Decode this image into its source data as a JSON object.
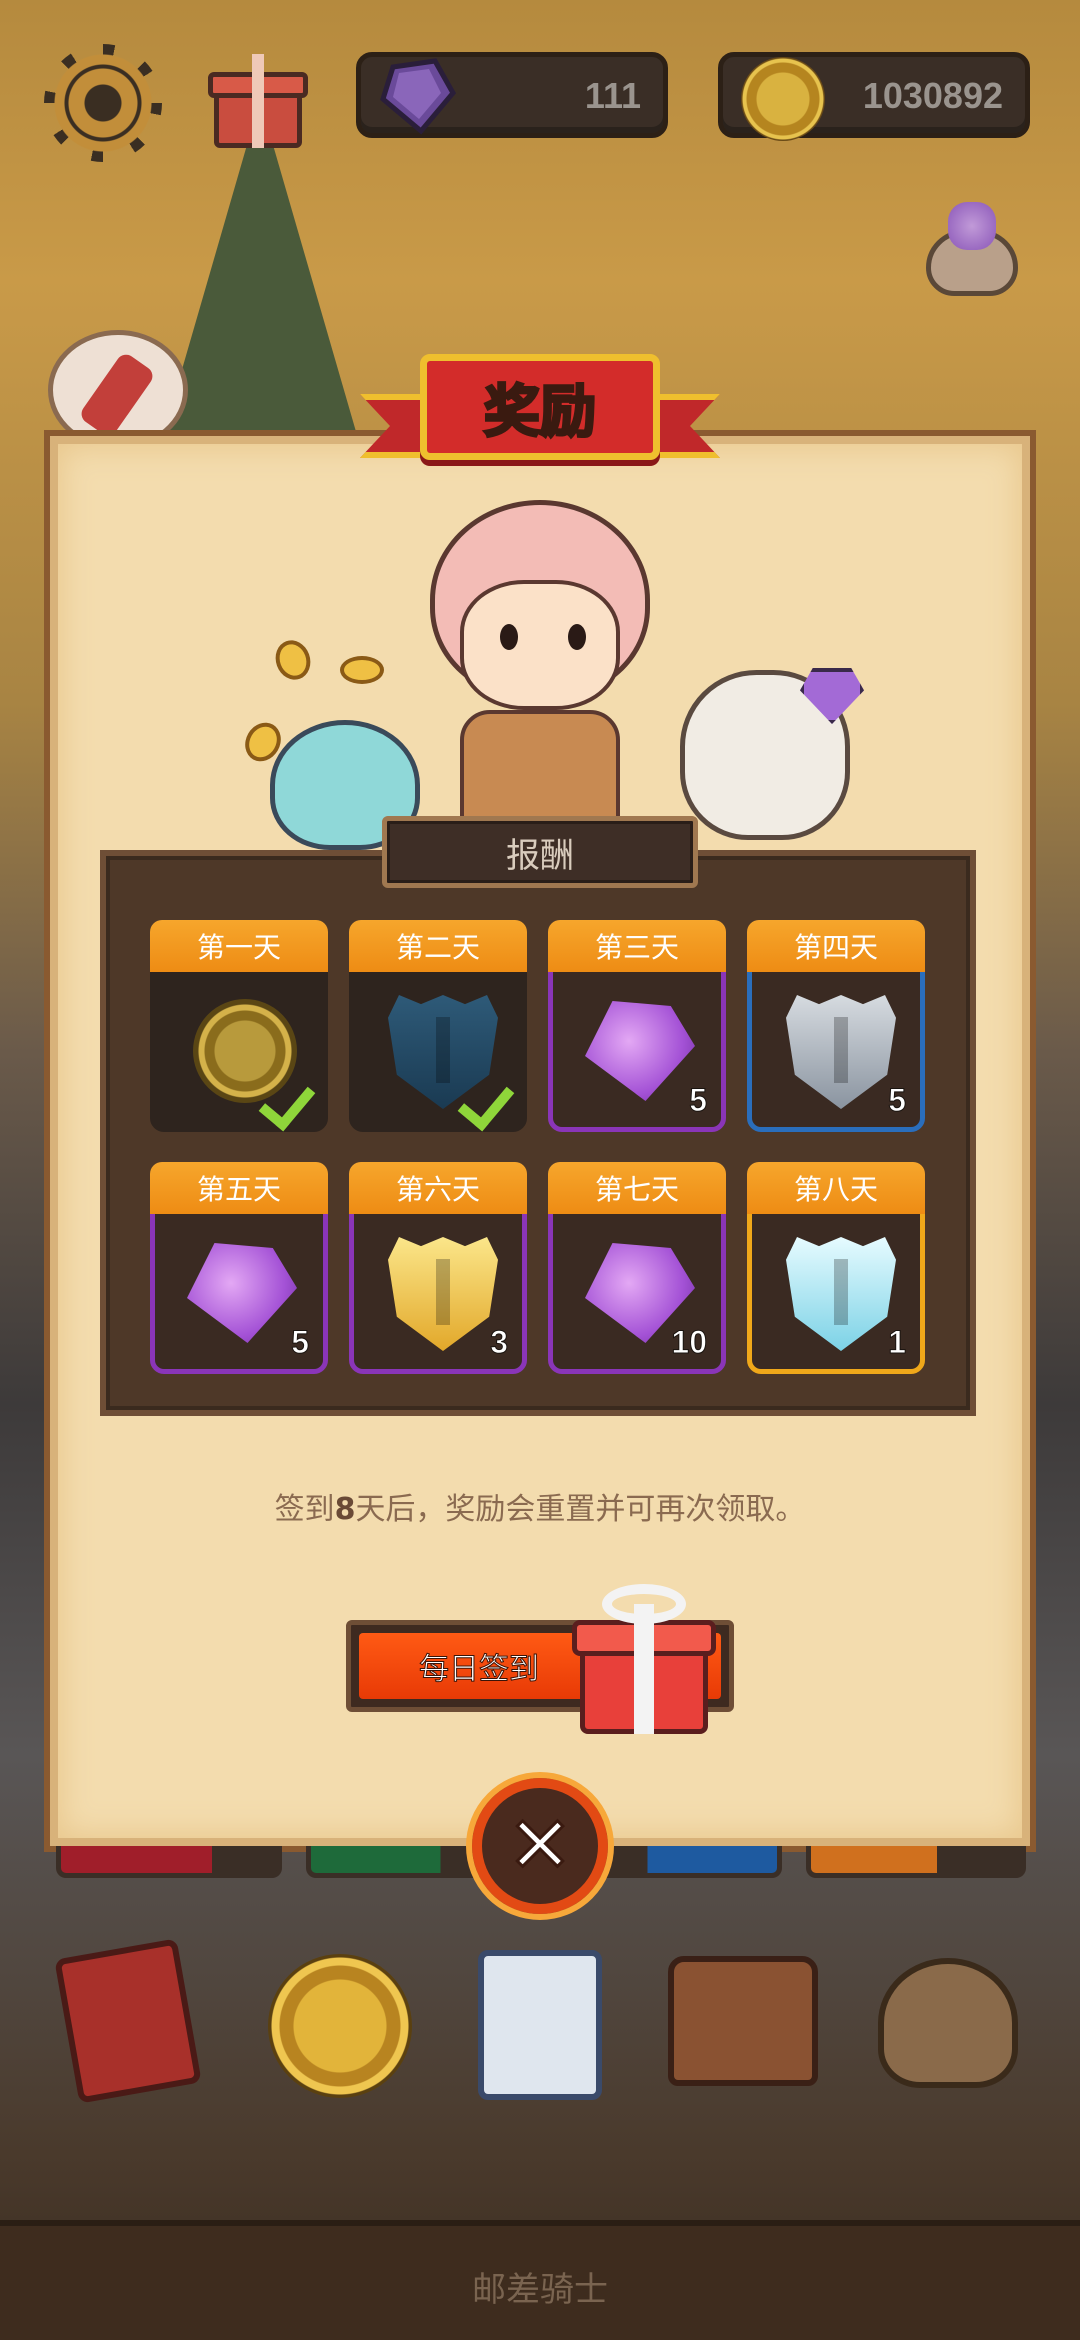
{
  "topbar": {
    "settings_icon": "gear-icon",
    "gift_icon": "gift-icon",
    "gems": "111",
    "coins": "1030892"
  },
  "dialog": {
    "title": "奖励",
    "reward_section_title": "报酬",
    "rewards": [
      {
        "day": "第一天",
        "item": "coin",
        "quantity": "",
        "claimed": true,
        "rarity": "none"
      },
      {
        "day": "第二天",
        "item": "dark-shield",
        "quantity": "",
        "claimed": true,
        "rarity": "none"
      },
      {
        "day": "第三天",
        "item": "gem",
        "quantity": "5",
        "claimed": false,
        "rarity": "purple"
      },
      {
        "day": "第四天",
        "item": "silver-shield",
        "quantity": "5",
        "claimed": false,
        "rarity": "blue"
      },
      {
        "day": "第五天",
        "item": "gem",
        "quantity": "5",
        "claimed": false,
        "rarity": "purple"
      },
      {
        "day": "第六天",
        "item": "golden-shield",
        "quantity": "3",
        "claimed": false,
        "rarity": "purple"
      },
      {
        "day": "第七天",
        "item": "gem",
        "quantity": "10",
        "claimed": false,
        "rarity": "purple"
      },
      {
        "day": "第八天",
        "item": "ice-shield",
        "quantity": "1",
        "claimed": false,
        "rarity": "gold"
      }
    ],
    "note_prefix": "签到",
    "note_days": "8",
    "note_suffix": "天后，奖励会重置并可再次领取。",
    "signin_button": "每日签到",
    "close_icon": "close-icon"
  },
  "dock": [
    "book-icon",
    "coin-icon",
    "cards-icon",
    "satchel-icon",
    "treasure-sack-icon"
  ],
  "footer": {
    "title": "邮差骑士"
  },
  "colors": {
    "accent_orange": "#ee8c14",
    "banner_red": "#d32c2a",
    "rarity_purple": "#8a35b8",
    "rarity_blue": "#2a6ebc",
    "rarity_gold": "#f0a81a",
    "check_green": "#8fd63a"
  }
}
